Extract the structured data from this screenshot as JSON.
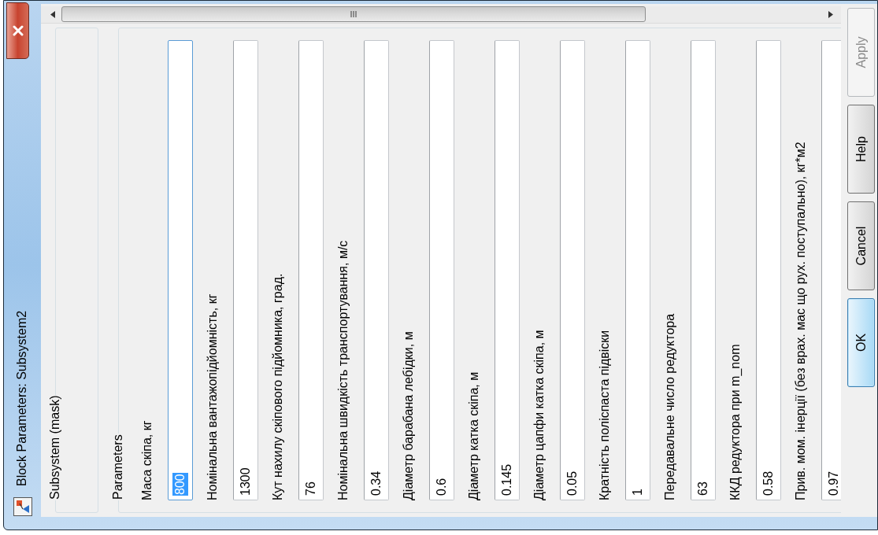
{
  "window": {
    "title": "Block Parameters: Subsystem2"
  },
  "mask_group": {
    "title": "Subsystem (mask)"
  },
  "parameters_group": {
    "title": "Parameters",
    "params": [
      {
        "label": "Маса скіпа, кг",
        "value": "800",
        "focused": true
      },
      {
        "label": "Номінальна вантажопідйомність, кг",
        "value": "1300",
        "focused": false
      },
      {
        "label": "Кут нахилу скіпового підйомника, град.",
        "value": "76",
        "focused": false
      },
      {
        "label": "Номінальна швидкість транспортування, м/с",
        "value": "0.34",
        "focused": false
      },
      {
        "label": "Діаметр барабана лебідки, м",
        "value": "0.6",
        "focused": false
      },
      {
        "label": "Діаметр катка скіпа, м",
        "value": "0.145",
        "focused": false
      },
      {
        "label": "Діаметр цапфи катка скіпа, м",
        "value": "0.05",
        "focused": false
      },
      {
        "label": "Кратність поліспаста підвіски",
        "value": "1",
        "focused": false
      },
      {
        "label": "Передавальне число редуктора",
        "value": "63",
        "focused": false
      },
      {
        "label": "ККД редуктора при m_nom",
        "value": "0.58",
        "focused": false
      },
      {
        "label": "Прив. мом. інерції (без врах. мас що рух. поступально), кг*м2",
        "value": "0.97",
        "focused": false
      }
    ]
  },
  "buttons": [
    {
      "label": "OK",
      "default": true,
      "disabled": false
    },
    {
      "label": "Cancel",
      "default": false,
      "disabled": false
    },
    {
      "label": "Help",
      "default": false,
      "disabled": false
    },
    {
      "label": "Apply",
      "default": false,
      "disabled": true
    }
  ]
}
